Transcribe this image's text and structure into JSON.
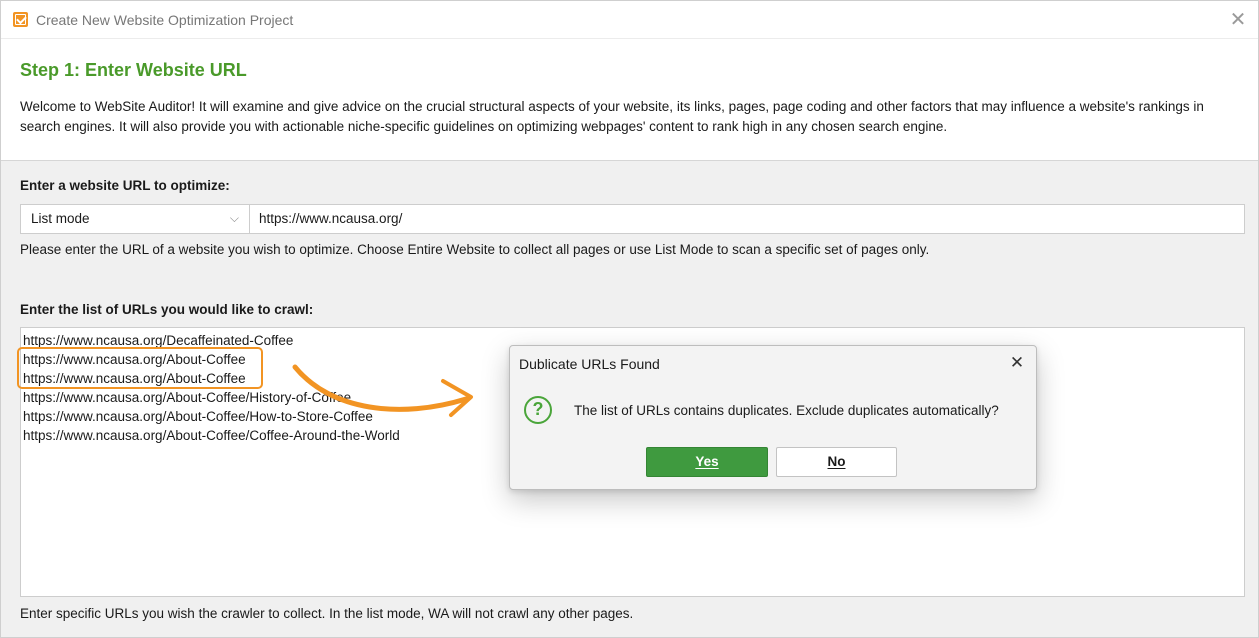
{
  "window": {
    "title": "Create New Website Optimization Project",
    "close_glyph": "✕"
  },
  "intro": {
    "step_title": "Step 1: Enter Website URL",
    "description": "Welcome to WebSite Auditor! It will examine and give advice on the crucial structural aspects of your website, its links, pages, page coding and other factors that may influence a website's rankings in search engines. It will also provide you with actionable niche-specific guidelines on optimizing webpages' content to rank high in any chosen search engine."
  },
  "url_section": {
    "label": "Enter a website URL to optimize:",
    "mode_selected": "List mode",
    "url_value": "https://www.ncausa.org/",
    "hint": "Please enter the URL of a website you wish to optimize. Choose Entire Website to collect all pages or use List Mode to scan a specific set of pages only."
  },
  "list_section": {
    "label": "Enter the list of URLs you would like to crawl:",
    "urls": [
      "https://www.ncausa.org/Decaffeinated-Coffee",
      "https://www.ncausa.org/About-Coffee",
      "https://www.ncausa.org/About-Coffee",
      "https://www.ncausa.org/About-Coffee/History-of-Coffee",
      "https://www.ncausa.org/About-Coffee/How-to-Store-Coffee",
      "https://www.ncausa.org/About-Coffee/Coffee-Around-the-World"
    ],
    "hint": "Enter specific URLs you wish the crawler to collect. In the list mode, WA will not crawl any other pages."
  },
  "dialog": {
    "title": "Dublicate URLs Found",
    "message": "The list of URLs contains duplicates. Exclude duplicates automatically?",
    "yes_label": "Yes",
    "no_label": "No",
    "close_glyph": "✕",
    "icon": "question-icon"
  },
  "colors": {
    "accent_green": "#4a9a2a",
    "button_green": "#3f9a3f",
    "highlight_orange": "#f29423"
  }
}
